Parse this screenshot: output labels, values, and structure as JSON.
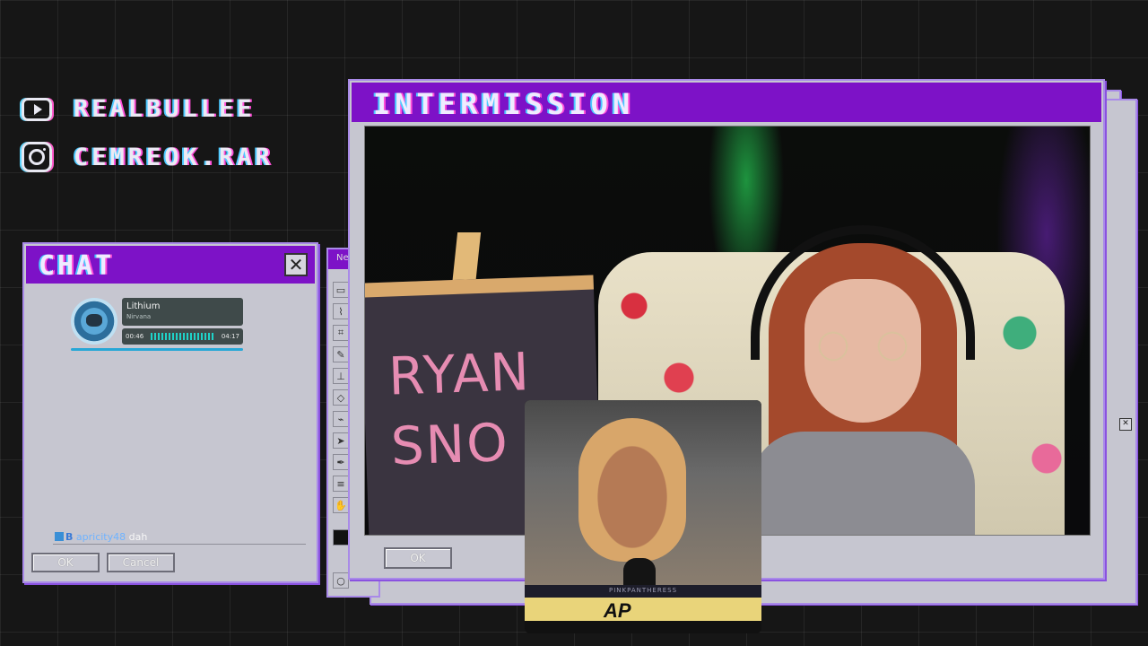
{
  "socials": [
    {
      "platform_icon": "youtube-icon",
      "handle": "REALBULLEE"
    },
    {
      "platform_icon": "instagram-icon",
      "handle": "CEMREOK.RAR"
    }
  ],
  "chat_window": {
    "title": "CHAT",
    "close_glyph": "✕",
    "now_playing": {
      "song": "Lithium",
      "artist": "Nirvana",
      "elapsed": "00:46",
      "total": "04:17",
      "progress": 0.18
    },
    "message": {
      "badge_letter": "B",
      "user": "apricity48",
      "text": "dah"
    },
    "ok_label": "OK",
    "cancel_label": "Cancel"
  },
  "paint_window": {
    "title_fragment": "Ne"
  },
  "intermission_window": {
    "title": "INTERMISSION",
    "ok_label": "OK",
    "board_text_line1": "RYAN",
    "board_text_line2": "SNO"
  },
  "video_overlay": {
    "caption": "PINKPANTHERESS",
    "logo": "AP"
  },
  "colors": {
    "titlebar": "#7d12c7",
    "window_bg": "#c6c6d0",
    "frame": "#a98ae8"
  }
}
